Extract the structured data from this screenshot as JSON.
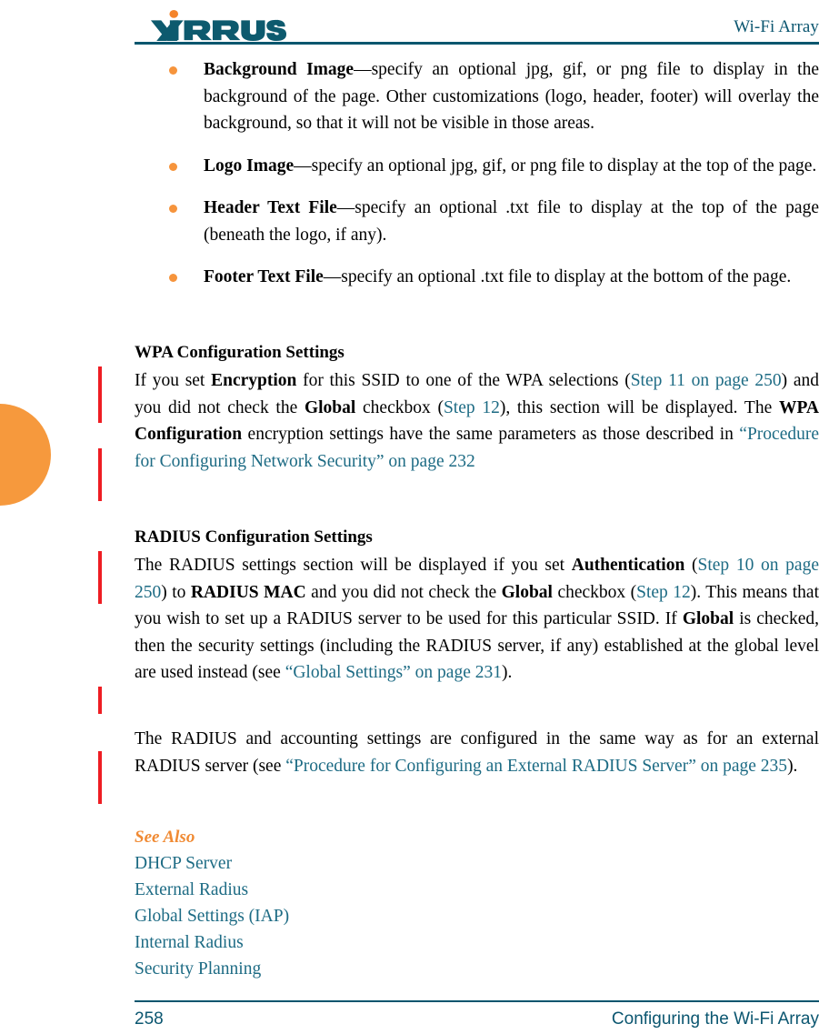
{
  "header": {
    "logo_text": "XIRRUS",
    "logo_mark": "xirrus-wordmark",
    "title": "Wi-Fi Array",
    "logo_color": "#0d5a6e",
    "logo_dot_color": "#f4842b",
    "rule_color": "#06566e"
  },
  "colors": {
    "xref": "#1d6b84",
    "accent_orange": "#f6943c",
    "changebar_red": "#ee1d23",
    "teal": "#0b5670"
  },
  "bullets": [
    {
      "term": "Background Image",
      "dash": "—",
      "text": "specify an optional jpg, gif, or png file to display in the background of the page. Other customizations (logo, header, footer) will overlay the background, so that it will not be visible in those areas."
    },
    {
      "term": "Logo Image",
      "dash": "—",
      "text": "specify an optional jpg, gif, or png file to display at the top of the page."
    },
    {
      "term": "Header Text File",
      "dash": "—",
      "text": "specify an optional .txt file to display at the top of the page (beneath the logo, if any)."
    },
    {
      "term": "Footer Text File",
      "dash": "—",
      "text": "specify an optional .txt file to display at the bottom of the page."
    }
  ],
  "wpa_section": {
    "heading": "WPA Configuration Settings",
    "p1_a": "If you set ",
    "p1_b": "Encryption",
    "p1_c": " for this SSID to one of the WPA selections (",
    "p1_xref1": "Step 11 on page 250",
    "p1_d": ") and you did not check the ",
    "p1_e": "Global",
    "p1_f": " checkbox (",
    "p1_xref2": "Step 12",
    "p1_g": "), this section will be displayed. The ",
    "p1_h": "WPA Configuration",
    "p1_i": " encryption settings have the same parameters as those described in ",
    "p1_xref3": "“Procedure for Configuring Network Security” on page 232"
  },
  "radius_section": {
    "heading": "RADIUS Configuration Settings",
    "p1_a": "The RADIUS settings section will be displayed if you set ",
    "p1_b": "Authentication",
    "p1_c": " (",
    "p1_xref1": "Step 10 on page 250",
    "p1_d": ") to ",
    "p1_e": "RADIUS MAC",
    "p1_f": " and you did not check the ",
    "p1_g": "Global",
    "p1_h": " checkbox (",
    "p1_xref2": "Step 12",
    "p1_i": "). This means that you wish to set up a RADIUS server to be used for this particular SSID. If ",
    "p1_j": "Global",
    "p1_k": " is checked, then the security settings (including the RADIUS server, if any) established at the global level are used instead (see ",
    "p1_xref3": "“Global Settings” on page 231",
    "p1_l": ").",
    "p2_a": "The RADIUS and accounting settings are configured in the same way as for an external RADIUS server (see ",
    "p2_xref1": "“Procedure for Configuring an External RADIUS Server” on page 235",
    "p2_b": ")."
  },
  "see_also": {
    "heading": "See Also",
    "links": [
      "DHCP Server",
      "External Radius",
      "Global Settings (IAP)",
      "Internal Radius",
      "Security Planning"
    ]
  },
  "footer": {
    "page_number": "258",
    "title": "Configuring the Wi-Fi Array"
  }
}
